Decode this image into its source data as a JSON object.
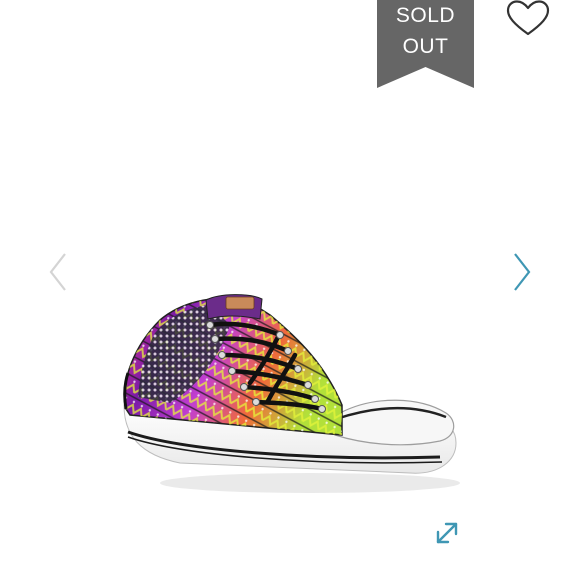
{
  "badge": {
    "line1": "SOLD",
    "line2": "OUT",
    "color": "#666666"
  },
  "product_image": {
    "subject": "converse-low-top-sneaker-tribal-print"
  },
  "icons": {
    "favorite": "heart-outline-icon",
    "previous": "chevron-left-icon",
    "next": "chevron-right-icon",
    "expand": "expand-diagonal-icon"
  },
  "colors": {
    "accent": "#3f97b4",
    "arrow_disabled": "#d4d4d4",
    "badge_bg": "#666666",
    "heart_stroke": "#333333"
  }
}
